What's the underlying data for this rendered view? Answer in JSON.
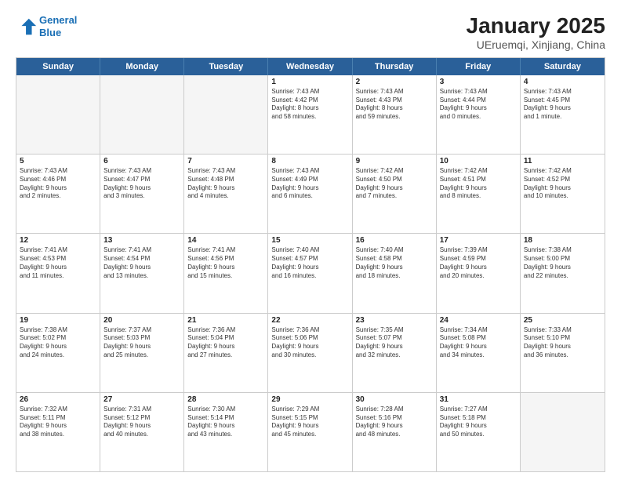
{
  "header": {
    "logo_line1": "General",
    "logo_line2": "Blue",
    "title": "January 2025",
    "subtitle": "UEruemqi, Xinjiang, China"
  },
  "weekdays": [
    "Sunday",
    "Monday",
    "Tuesday",
    "Wednesday",
    "Thursday",
    "Friday",
    "Saturday"
  ],
  "rows": [
    [
      {
        "day": "",
        "text": "",
        "empty": true
      },
      {
        "day": "",
        "text": "",
        "empty": true
      },
      {
        "day": "",
        "text": "",
        "empty": true
      },
      {
        "day": "1",
        "text": "Sunrise: 7:43 AM\nSunset: 4:42 PM\nDaylight: 8 hours\nand 58 minutes.",
        "empty": false
      },
      {
        "day": "2",
        "text": "Sunrise: 7:43 AM\nSunset: 4:43 PM\nDaylight: 8 hours\nand 59 minutes.",
        "empty": false
      },
      {
        "day": "3",
        "text": "Sunrise: 7:43 AM\nSunset: 4:44 PM\nDaylight: 9 hours\nand 0 minutes.",
        "empty": false
      },
      {
        "day": "4",
        "text": "Sunrise: 7:43 AM\nSunset: 4:45 PM\nDaylight: 9 hours\nand 1 minute.",
        "empty": false
      }
    ],
    [
      {
        "day": "5",
        "text": "Sunrise: 7:43 AM\nSunset: 4:46 PM\nDaylight: 9 hours\nand 2 minutes.",
        "empty": false
      },
      {
        "day": "6",
        "text": "Sunrise: 7:43 AM\nSunset: 4:47 PM\nDaylight: 9 hours\nand 3 minutes.",
        "empty": false
      },
      {
        "day": "7",
        "text": "Sunrise: 7:43 AM\nSunset: 4:48 PM\nDaylight: 9 hours\nand 4 minutes.",
        "empty": false
      },
      {
        "day": "8",
        "text": "Sunrise: 7:43 AM\nSunset: 4:49 PM\nDaylight: 9 hours\nand 6 minutes.",
        "empty": false
      },
      {
        "day": "9",
        "text": "Sunrise: 7:42 AM\nSunset: 4:50 PM\nDaylight: 9 hours\nand 7 minutes.",
        "empty": false
      },
      {
        "day": "10",
        "text": "Sunrise: 7:42 AM\nSunset: 4:51 PM\nDaylight: 9 hours\nand 8 minutes.",
        "empty": false
      },
      {
        "day": "11",
        "text": "Sunrise: 7:42 AM\nSunset: 4:52 PM\nDaylight: 9 hours\nand 10 minutes.",
        "empty": false
      }
    ],
    [
      {
        "day": "12",
        "text": "Sunrise: 7:41 AM\nSunset: 4:53 PM\nDaylight: 9 hours\nand 11 minutes.",
        "empty": false
      },
      {
        "day": "13",
        "text": "Sunrise: 7:41 AM\nSunset: 4:54 PM\nDaylight: 9 hours\nand 13 minutes.",
        "empty": false
      },
      {
        "day": "14",
        "text": "Sunrise: 7:41 AM\nSunset: 4:56 PM\nDaylight: 9 hours\nand 15 minutes.",
        "empty": false
      },
      {
        "day": "15",
        "text": "Sunrise: 7:40 AM\nSunset: 4:57 PM\nDaylight: 9 hours\nand 16 minutes.",
        "empty": false
      },
      {
        "day": "16",
        "text": "Sunrise: 7:40 AM\nSunset: 4:58 PM\nDaylight: 9 hours\nand 18 minutes.",
        "empty": false
      },
      {
        "day": "17",
        "text": "Sunrise: 7:39 AM\nSunset: 4:59 PM\nDaylight: 9 hours\nand 20 minutes.",
        "empty": false
      },
      {
        "day": "18",
        "text": "Sunrise: 7:38 AM\nSunset: 5:00 PM\nDaylight: 9 hours\nand 22 minutes.",
        "empty": false
      }
    ],
    [
      {
        "day": "19",
        "text": "Sunrise: 7:38 AM\nSunset: 5:02 PM\nDaylight: 9 hours\nand 24 minutes.",
        "empty": false
      },
      {
        "day": "20",
        "text": "Sunrise: 7:37 AM\nSunset: 5:03 PM\nDaylight: 9 hours\nand 25 minutes.",
        "empty": false
      },
      {
        "day": "21",
        "text": "Sunrise: 7:36 AM\nSunset: 5:04 PM\nDaylight: 9 hours\nand 27 minutes.",
        "empty": false
      },
      {
        "day": "22",
        "text": "Sunrise: 7:36 AM\nSunset: 5:06 PM\nDaylight: 9 hours\nand 30 minutes.",
        "empty": false
      },
      {
        "day": "23",
        "text": "Sunrise: 7:35 AM\nSunset: 5:07 PM\nDaylight: 9 hours\nand 32 minutes.",
        "empty": false
      },
      {
        "day": "24",
        "text": "Sunrise: 7:34 AM\nSunset: 5:08 PM\nDaylight: 9 hours\nand 34 minutes.",
        "empty": false
      },
      {
        "day": "25",
        "text": "Sunrise: 7:33 AM\nSunset: 5:10 PM\nDaylight: 9 hours\nand 36 minutes.",
        "empty": false
      }
    ],
    [
      {
        "day": "26",
        "text": "Sunrise: 7:32 AM\nSunset: 5:11 PM\nDaylight: 9 hours\nand 38 minutes.",
        "empty": false
      },
      {
        "day": "27",
        "text": "Sunrise: 7:31 AM\nSunset: 5:12 PM\nDaylight: 9 hours\nand 40 minutes.",
        "empty": false
      },
      {
        "day": "28",
        "text": "Sunrise: 7:30 AM\nSunset: 5:14 PM\nDaylight: 9 hours\nand 43 minutes.",
        "empty": false
      },
      {
        "day": "29",
        "text": "Sunrise: 7:29 AM\nSunset: 5:15 PM\nDaylight: 9 hours\nand 45 minutes.",
        "empty": false
      },
      {
        "day": "30",
        "text": "Sunrise: 7:28 AM\nSunset: 5:16 PM\nDaylight: 9 hours\nand 48 minutes.",
        "empty": false
      },
      {
        "day": "31",
        "text": "Sunrise: 7:27 AM\nSunset: 5:18 PM\nDaylight: 9 hours\nand 50 minutes.",
        "empty": false
      },
      {
        "day": "",
        "text": "",
        "empty": true
      }
    ]
  ]
}
